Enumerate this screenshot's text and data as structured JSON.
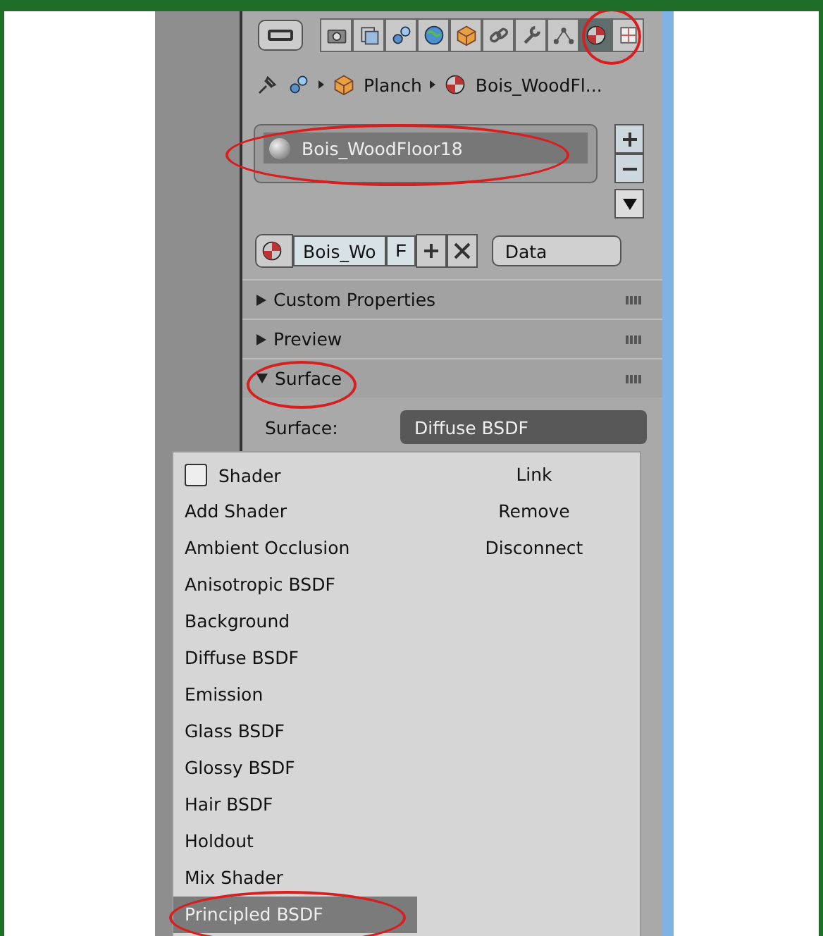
{
  "toolbar": {
    "tabs": [
      {
        "kind": "render",
        "selected": false
      },
      {
        "kind": "layers",
        "selected": false
      },
      {
        "kind": "scene",
        "selected": false
      },
      {
        "kind": "world",
        "selected": false
      },
      {
        "kind": "object",
        "selected": false
      },
      {
        "kind": "constraints",
        "selected": false
      },
      {
        "kind": "modifiers",
        "selected": false
      },
      {
        "kind": "data",
        "selected": false
      },
      {
        "kind": "material",
        "selected": true
      },
      {
        "kind": "texture",
        "selected": false
      }
    ]
  },
  "breadcrumb": {
    "object": "Planch",
    "material": "Bois_WoodFl..."
  },
  "material_slots": {
    "items": [
      {
        "label": "Bois_WoodFloor18",
        "selected": true
      }
    ]
  },
  "material_selector": {
    "name": "Bois_Wo",
    "fake_user": "F",
    "link": "Data"
  },
  "panels": [
    {
      "title": "Custom Properties",
      "expanded": false
    },
    {
      "title": "Preview",
      "expanded": false
    },
    {
      "title": "Surface",
      "expanded": true
    }
  ],
  "surface": {
    "label": "Surface:",
    "value": "Diffuse BSDF"
  },
  "menu": {
    "header": "Shader",
    "actions": [
      "Link",
      "Remove",
      "Disconnect"
    ],
    "items": [
      {
        "label": "Add Shader",
        "selected": false
      },
      {
        "label": "Ambient Occlusion",
        "selected": false
      },
      {
        "label": "Anisotropic BSDF",
        "selected": false
      },
      {
        "label": "Background",
        "selected": false
      },
      {
        "label": "Diffuse BSDF",
        "selected": false
      },
      {
        "label": "Emission",
        "selected": false
      },
      {
        "label": "Glass BSDF",
        "selected": false
      },
      {
        "label": "Glossy BSDF",
        "selected": false
      },
      {
        "label": "Hair BSDF",
        "selected": false
      },
      {
        "label": "Holdout",
        "selected": false
      },
      {
        "label": "Mix Shader",
        "selected": false
      },
      {
        "label": "Principled BSDF",
        "selected": true
      }
    ]
  }
}
